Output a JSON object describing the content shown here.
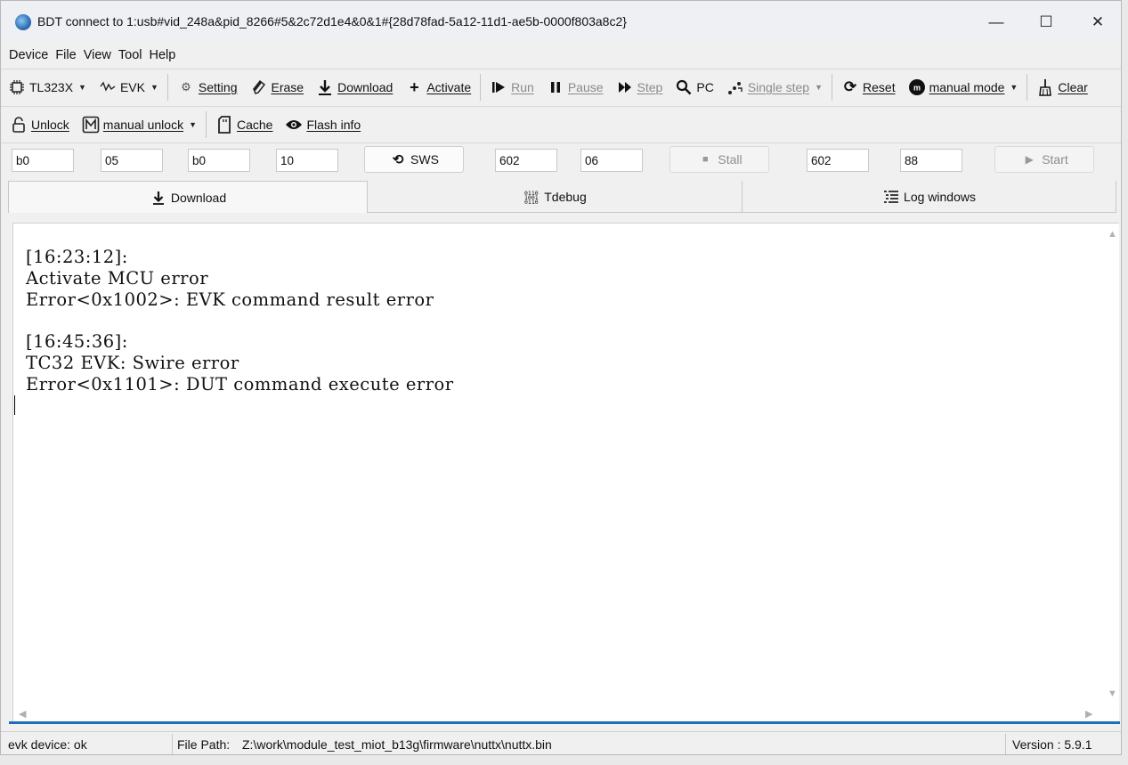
{
  "window": {
    "title": "BDT connect to 1:usb#vid_248a&pid_8266#5&2c72d1e4&0&1#{28d78fad-5a12-11d1-ae5b-0000f803a8c2}",
    "controls": {
      "minimize": "—",
      "maximize": "☐",
      "close": "✕"
    }
  },
  "menu": [
    "Device",
    "File",
    "View",
    "Tool",
    "Help"
  ],
  "toolbar1": {
    "chip": "TL323X",
    "evk": "EVK",
    "setting": "Setting",
    "erase": "Erase",
    "download": "Download",
    "activate": "Activate",
    "run": "Run",
    "pause": "Pause",
    "step": "Step",
    "pc": "PC",
    "single_step": "Single step",
    "reset": "Reset",
    "mode": "manual mode",
    "clear": "Clear"
  },
  "toolbar2": {
    "unlock": "Unlock",
    "manual_unlock": "manual unlock",
    "cache": "Cache",
    "flash_info": "Flash info"
  },
  "inputs": {
    "f1": "b0",
    "f2": "05",
    "f3": "b0",
    "f4": "10",
    "sws": "SWS",
    "f5": "602",
    "f6": "06",
    "stall": "Stall",
    "f7": "602",
    "f8": "88",
    "start": "Start"
  },
  "tabs": [
    "Download",
    "Tdebug",
    "Log windows"
  ],
  "log": [
    "[16:23:12]:",
    "Activate MCU error",
    "Error<0x1002>: EVK command result error",
    "",
    "[16:45:36]:",
    "TC32 EVK: Swire error",
    "Error<0x1101>: DUT command execute error"
  ],
  "status": {
    "device": "evk device: ok",
    "file_path_label": "File Path:",
    "file_path": "Z:\\work\\module_test_miot_b13g\\firmware\\nuttx\\nuttx.bin",
    "version": "Version : 5.9.1"
  },
  "colors": {
    "accent": "#1e6fb9",
    "disabled_text": "#8a8a8a",
    "window_bg": "#f0f0f0"
  }
}
